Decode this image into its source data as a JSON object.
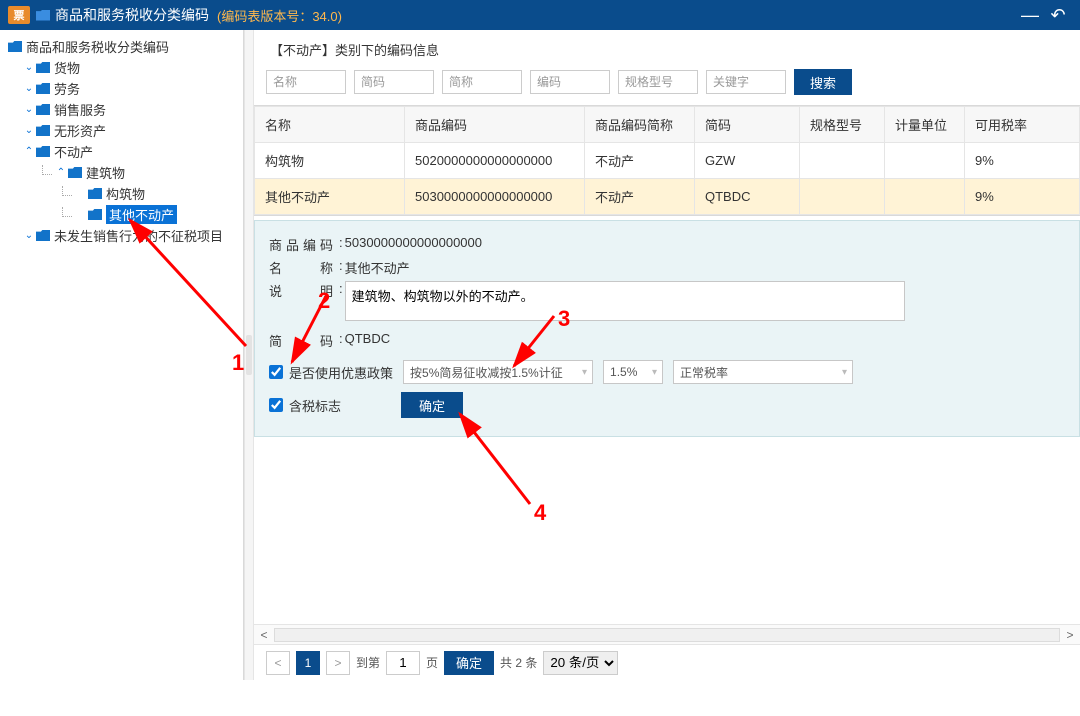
{
  "titlebar": {
    "logo_text": "票",
    "title": "商品和服务税收分类编码",
    "version": "(编码表版本号：34.0)"
  },
  "tree": {
    "root": "商品和服务税收分类编码",
    "n0": "货物",
    "n1": "劳务",
    "n2": "销售服务",
    "n3": "无形资产",
    "n4": "不动产",
    "n4_0": "建筑物",
    "n4_0_0": "构筑物",
    "n4_0_1": "其他不动产",
    "n5": "未发生销售行为的不征税项目"
  },
  "crumb": "【不动产】类别下的编码信息",
  "filters": {
    "p0": "名称",
    "p1": "简码",
    "p2": "简称",
    "p3": "编码",
    "p4": "规格型号",
    "p5": "关键字",
    "search": "搜索"
  },
  "table": {
    "headers": [
      "名称",
      "商品编码",
      "商品编码简称",
      "简码",
      "规格型号",
      "计量单位",
      "可用税率"
    ],
    "rows": [
      {
        "c0": "构筑物",
        "c1": "5020000000000000000",
        "c2": "不动产",
        "c3": "GZW",
        "c4": "",
        "c5": "",
        "c6": "9%"
      },
      {
        "c0": "其他不动产",
        "c1": "5030000000000000000",
        "c2": "不动产",
        "c3": "QTBDC",
        "c4": "",
        "c5": "",
        "c6": "9%"
      }
    ]
  },
  "detail": {
    "code_label": "商品编码",
    "code_value": "5030000000000000000",
    "name_label": "名　　称",
    "name_value": "其他不动产",
    "desc_label": "说　　明",
    "desc_value": "建筑物、构筑物以外的不动产。",
    "short_label": "简　　码",
    "short_value": "QTBDC",
    "use_policy": "是否使用优惠政策",
    "policy_sel": "按5%简易征收减按1.5%计征",
    "rate_sel": "1.5%",
    "rate_note": "正常税率",
    "tax_flag": "含税标志",
    "confirm": "确定"
  },
  "pager": {
    "goto": "到第",
    "page_unit": "页",
    "page_num": "1",
    "confirm": "确定",
    "total": "共 2 条",
    "per_page": "20 条/页"
  },
  "annotations": {
    "a1": "1",
    "a2": "2",
    "a3": "3",
    "a4": "4"
  }
}
